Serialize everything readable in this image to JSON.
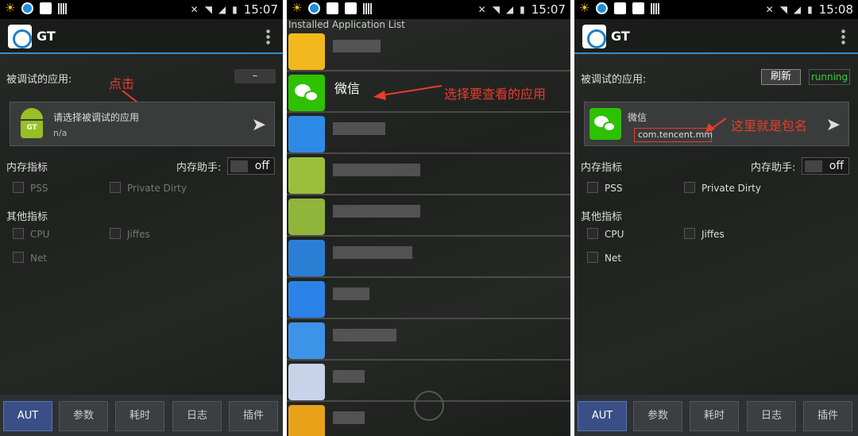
{
  "status": {
    "time1": "15:07",
    "time2": "15:07",
    "time3": "15:08"
  },
  "app": {
    "title": "GT"
  },
  "panel1": {
    "debug_app_label": "被调试的应用:",
    "minus_label": "–",
    "select_app_text": "请选择被调试的应用",
    "na_text": "n/a",
    "note": "点击",
    "mem_section": "内存指标",
    "mem_helper": "内存助手:",
    "toggle_state": "off",
    "pss": "PSS",
    "private_dirty": "Private Dirty",
    "other_section": "其他指标",
    "cpu": "CPU",
    "jiffes": "Jiffes",
    "net": "Net"
  },
  "panel2": {
    "header": "Installed Application List",
    "wechat": "微信",
    "note": "选择要查看的应用"
  },
  "panel3": {
    "debug_app_label": "被调试的应用:",
    "refresh": "刷新",
    "running": "running",
    "app_name": "微信",
    "package": "com.tencent.mm",
    "note": "这里就是包名",
    "mem_section": "内存指标",
    "mem_helper": "内存助手:",
    "toggle_state": "off",
    "pss": "PSS",
    "private_dirty": "Private Dirty",
    "other_section": "其他指标",
    "cpu": "CPU",
    "jiffes": "Jiffes",
    "net": "Net"
  },
  "tabs": [
    "AUT",
    "参数",
    "耗时",
    "日志",
    "插件"
  ],
  "colors": {
    "accent": "#2f8fce",
    "annotation": "#e83c2c",
    "wechat": "#2dc100",
    "running": "#2fd52f"
  }
}
